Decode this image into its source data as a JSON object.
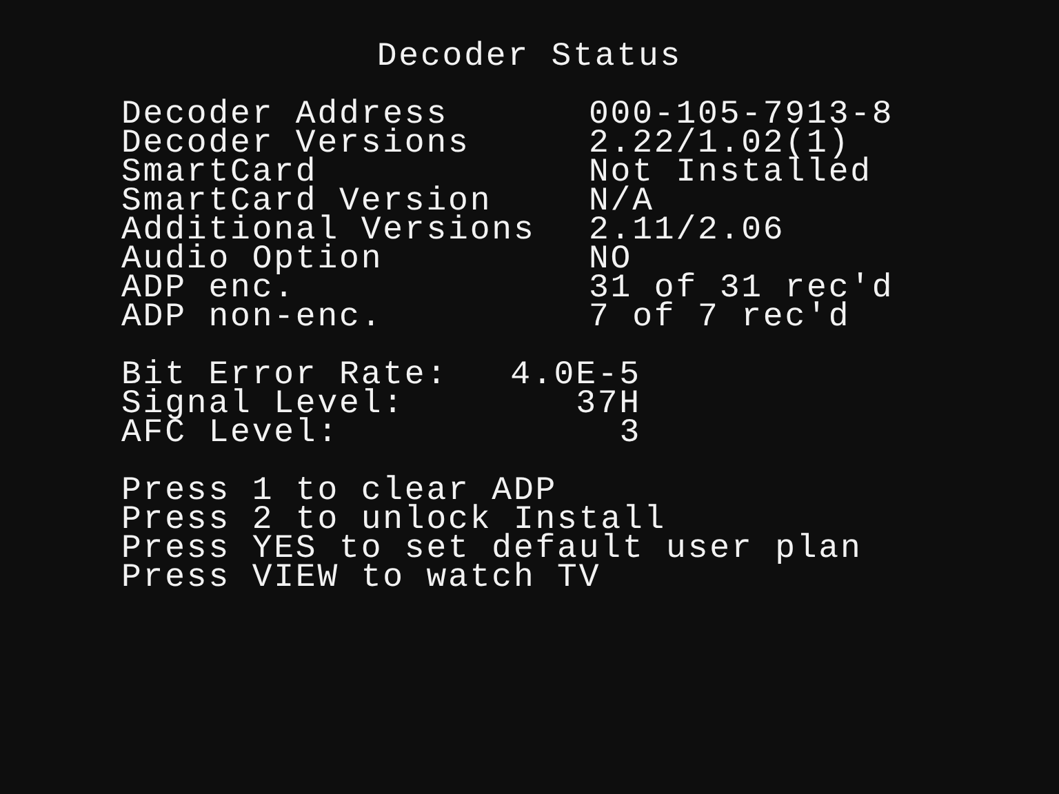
{
  "title": "Decoder Status",
  "info": [
    {
      "label": "Decoder Address",
      "value": "000-105-7913-8"
    },
    {
      "label": "Decoder Versions",
      "value": "2.22/1.02(1)"
    },
    {
      "label": "SmartCard",
      "value": "Not Installed"
    },
    {
      "label": "SmartCard Version",
      "value": "N/A"
    },
    {
      "label": "Additional Versions",
      "value": "2.11/2.06"
    },
    {
      "label": "Audio Option",
      "value": "NO"
    },
    {
      "label": "ADP enc.",
      "value": "31 of 31 rec'd"
    },
    {
      "label": "ADP non-enc.",
      "value": "7 of 7 rec'd"
    }
  ],
  "signal": [
    {
      "label": "Bit Error Rate:",
      "value": "4.0E-5"
    },
    {
      "label": "Signal Level:",
      "value": "37H"
    },
    {
      "label": "AFC Level:",
      "value": "3"
    }
  ],
  "instructions": [
    "Press 1 to clear ADP",
    "Press 2 to unlock Install",
    "Press YES to set default user plan",
    "Press VIEW to watch TV"
  ]
}
